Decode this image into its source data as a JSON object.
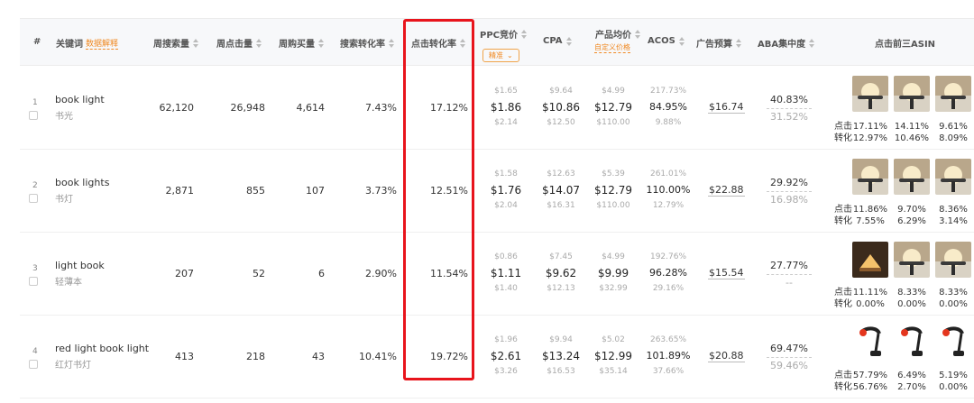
{
  "header": {
    "index": "#",
    "keyword": "关键词",
    "keyword_link": "数据解释",
    "weekly_search": "周搜索量",
    "weekly_clicks": "周点击量",
    "weekly_purchases": "周购买量",
    "search_conversion": "搜索转化率",
    "click_conversion": "点击转化率",
    "ppc": "PPC竞价",
    "ppc_dropdown": "精准",
    "cpa": "CPA",
    "avg_price": "产品均价",
    "custom_price": "自定义价格",
    "acos": "ACOS",
    "ad_budget": "广告预算",
    "aba": "ABA集中度",
    "top3_asin": "点击前三ASIN"
  },
  "asin_labels": {
    "click": "点击",
    "conversion": "转化"
  },
  "rows": [
    {
      "index": "1",
      "keyword": "book light",
      "keyword_cn": "书光",
      "weekly_search": "62,120",
      "weekly_clicks": "26,948",
      "weekly_purchases": "4,614",
      "search_conversion": "7.43%",
      "click_conversion": "17.12%",
      "ppc": {
        "low": "$1.65",
        "mid": "$1.86",
        "high": "$2.14"
      },
      "cpa": {
        "low": "$9.64",
        "mid": "$10.86",
        "high": "$12.50"
      },
      "price": {
        "low": "$4.99",
        "mid": "$12.79",
        "high": "$110.00"
      },
      "acos": {
        "low": "217.73%",
        "mid": "84.95%",
        "high": "9.88%"
      },
      "budget": "$16.74",
      "aba_primary": "40.83%",
      "aba_secondary": "31.52%",
      "asins": [
        {
          "click": "17.11%",
          "conversion": "12.97%",
          "icon": "book-light-product-icon"
        },
        {
          "click": "14.11%",
          "conversion": "10.46%",
          "icon": "book-light-product-icon"
        },
        {
          "click": "9.61%",
          "conversion": "8.09%",
          "icon": "book-light-product-icon"
        }
      ]
    },
    {
      "index": "2",
      "keyword": "book lights",
      "keyword_cn": "书灯",
      "weekly_search": "2,871",
      "weekly_clicks": "855",
      "weekly_purchases": "107",
      "search_conversion": "3.73%",
      "click_conversion": "12.51%",
      "ppc": {
        "low": "$1.58",
        "mid": "$1.76",
        "high": "$2.04"
      },
      "cpa": {
        "low": "$12.63",
        "mid": "$14.07",
        "high": "$16.31"
      },
      "price": {
        "low": "$5.39",
        "mid": "$12.79",
        "high": "$110.00"
      },
      "acos": {
        "low": "261.01%",
        "mid": "110.00%",
        "high": "12.79%"
      },
      "budget": "$22.88",
      "aba_primary": "29.92%",
      "aba_secondary": "16.98%",
      "asins": [
        {
          "click": "11.86%",
          "conversion": "7.55%",
          "icon": "book-light-product-icon"
        },
        {
          "click": "9.70%",
          "conversion": "6.29%",
          "icon": "book-light-product-icon"
        },
        {
          "click": "8.36%",
          "conversion": "3.14%",
          "icon": "book-light-product-icon"
        }
      ]
    },
    {
      "index": "3",
      "keyword": "light book",
      "keyword_cn": "轻薄本",
      "weekly_search": "207",
      "weekly_clicks": "52",
      "weekly_purchases": "6",
      "search_conversion": "2.90%",
      "click_conversion": "11.54%",
      "ppc": {
        "low": "$0.86",
        "mid": "$1.11",
        "high": "$1.40"
      },
      "cpa": {
        "low": "$7.45",
        "mid": "$9.62",
        "high": "$12.13"
      },
      "price": {
        "low": "$4.99",
        "mid": "$9.99",
        "high": "$32.99"
      },
      "acos": {
        "low": "192.76%",
        "mid": "96.28%",
        "high": "29.16%"
      },
      "budget": "$15.54",
      "aba_primary": "27.77%",
      "aba_secondary": "--",
      "asins": [
        {
          "click": "11.11%",
          "conversion": "0.00%",
          "icon": "book-lamp-product-icon"
        },
        {
          "click": "8.33%",
          "conversion": "0.00%",
          "icon": "book-light-product-icon"
        },
        {
          "click": "8.33%",
          "conversion": "0.00%",
          "icon": "book-light-product-icon"
        }
      ]
    },
    {
      "index": "4",
      "keyword": "red light book light",
      "keyword_cn": "红灯书灯",
      "weekly_search": "413",
      "weekly_clicks": "218",
      "weekly_purchases": "43",
      "search_conversion": "10.41%",
      "click_conversion": "19.72%",
      "ppc": {
        "low": "$1.96",
        "mid": "$2.61",
        "high": "$3.26"
      },
      "cpa": {
        "low": "$9.94",
        "mid": "$13.24",
        "high": "$16.53"
      },
      "price": {
        "low": "$5.02",
        "mid": "$12.99",
        "high": "$35.14"
      },
      "acos": {
        "low": "263.65%",
        "mid": "101.89%",
        "high": "37.66%"
      },
      "budget": "$20.88",
      "aba_primary": "69.47%",
      "aba_secondary": "59.46%",
      "asins": [
        {
          "click": "57.79%",
          "conversion": "56.76%",
          "icon": "red-clip-light-icon"
        },
        {
          "click": "6.49%",
          "conversion": "2.70%",
          "icon": "red-clip-light-icon"
        },
        {
          "click": "5.19%",
          "conversion": "0.00%",
          "icon": "red-clip-light-icon"
        }
      ]
    }
  ],
  "colors": {
    "highlight": "#e8141c",
    "accent": "#f08a24"
  }
}
